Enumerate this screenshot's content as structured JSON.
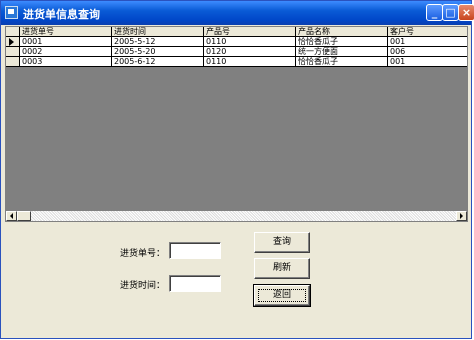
{
  "window": {
    "title": "进货单信息查询"
  },
  "titlebar_buttons": {
    "minimize": "_",
    "maximize": "□",
    "close": "×"
  },
  "grid": {
    "columns": [
      "进货单号",
      "进货时间",
      "产品号",
      "产品名称",
      "客户号"
    ],
    "rows": [
      [
        "0001",
        "2005-5-12",
        "0110",
        "恰恰香瓜子",
        "001"
      ],
      [
        "0002",
        "2005-5-20",
        "0120",
        "统一方便面",
        "006"
      ],
      [
        "0003",
        "2005-6-12",
        "0110",
        "恰恰香瓜子",
        "001"
      ]
    ]
  },
  "form": {
    "order_label": "进货单号：",
    "time_label": "进货时间：",
    "order_value": "",
    "time_value": ""
  },
  "buttons": {
    "query": "查询",
    "refresh": "刷新",
    "back": "返回"
  }
}
